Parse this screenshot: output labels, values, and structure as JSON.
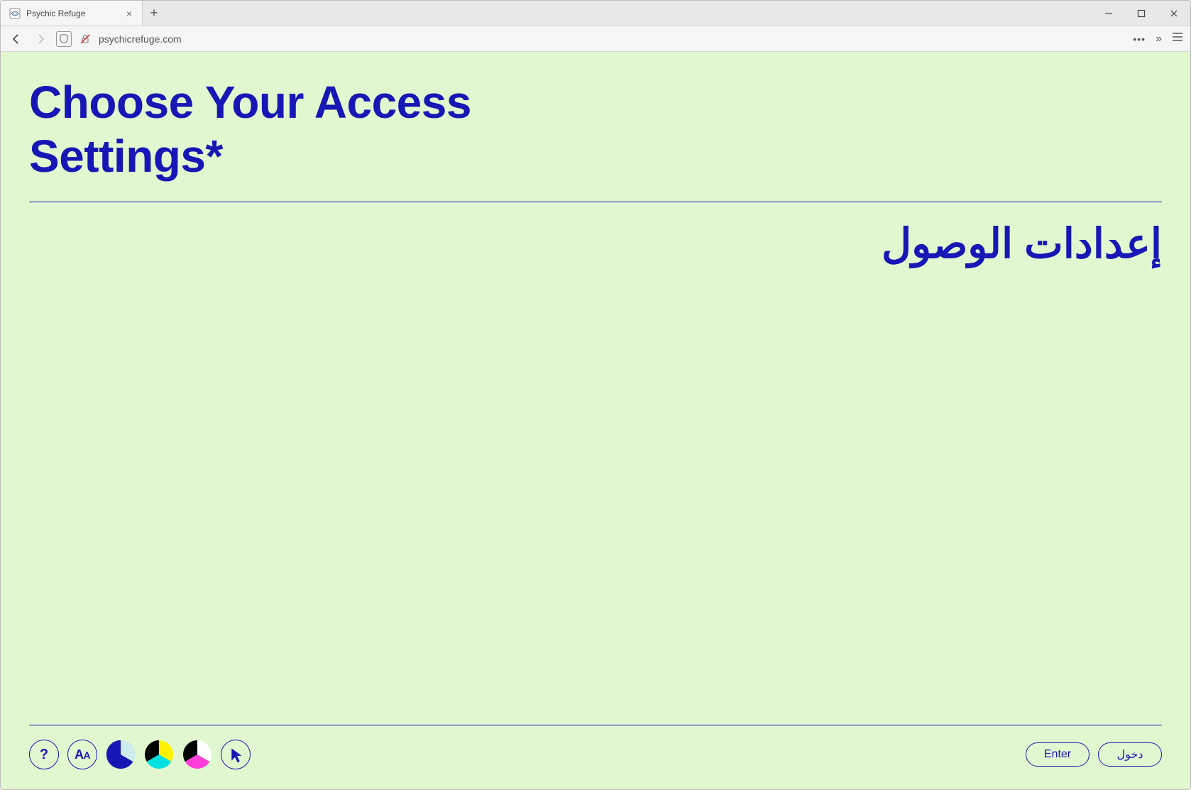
{
  "browser": {
    "tab_title": "Psychic Refuge",
    "url": "psychicrefuge.com"
  },
  "page": {
    "heading_en": "Choose Your Access Settings*",
    "heading_ar": "إعدادات الوصول",
    "footer": {
      "help_label": "?",
      "enter_label": "Enter",
      "enter_label_ar": "دخول"
    }
  },
  "colors": {
    "page_bg": "#e1f7d0",
    "primary": "#1617b4"
  }
}
